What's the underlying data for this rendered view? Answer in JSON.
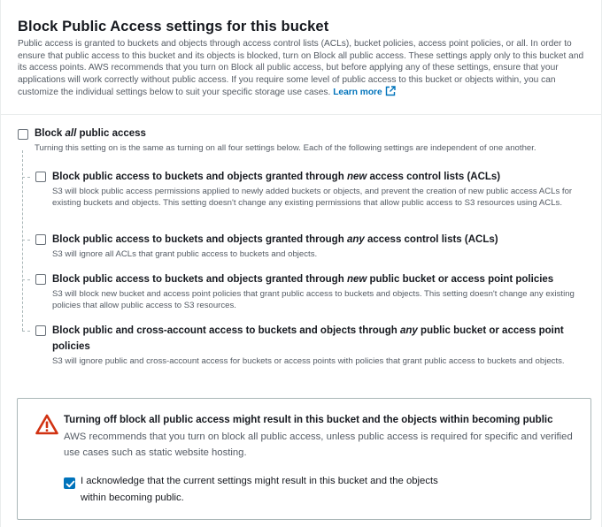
{
  "header": {
    "title": "Block Public Access settings for this bucket",
    "description": "Public access is granted to buckets and objects through access control lists (ACLs), bucket policies, access point policies, or all. In order to ensure that public access to this bucket and its objects is blocked, turn on Block all public access. These settings apply only to this bucket and its access points. AWS recommends that you turn on Block all public access, but before applying any of these settings, ensure that your applications will work correctly without public access. If you require some level of public access to this bucket or objects within, you can customize the individual settings below to suit your specific storage use cases.",
    "learn_more": "Learn more"
  },
  "block_all": {
    "label_pre": "Block ",
    "label_em": "all",
    "label_post": " public access",
    "description": "Turning this setting on is the same as turning on all four settings below. Each of the following settings are independent of one another.",
    "checked": false
  },
  "options": [
    {
      "label_pre": "Block public access to buckets and objects granted through ",
      "label_em": "new",
      "label_post": " access control lists (ACLs)",
      "description": "S3 will block public access permissions applied to newly added buckets or objects, and prevent the creation of new public access ACLs for existing buckets and objects. This setting doesn't change any existing permissions that allow public access to S3 resources using ACLs.",
      "checked": false
    },
    {
      "label_pre": "Block public access to buckets and objects granted through ",
      "label_em": "any",
      "label_post": " access control lists (ACLs)",
      "description": "S3 will ignore all ACLs that grant public access to buckets and objects.",
      "checked": false
    },
    {
      "label_pre": "Block public access to buckets and objects granted through ",
      "label_em": "new",
      "label_post": " public bucket or access point policies",
      "description": "S3 will block new bucket and access point policies that grant public access to buckets and objects. This setting doesn't change any existing policies that allow public access to S3 resources.",
      "checked": false
    },
    {
      "label_pre": "Block public and cross-account access to buckets and objects through ",
      "label_em": "any",
      "label_post": " public bucket or access point policies",
      "description": "S3 will ignore public and cross-account access for buckets or access points with policies that grant public access to buckets and objects.",
      "checked": false
    }
  ],
  "warning": {
    "title": "Turning off block all public access might result in this bucket and the objects within becoming public",
    "text": "AWS recommends that you turn on block all public access, unless public access is required for specific and verified use cases such as static website hosting.",
    "acknowledge": "I acknowledge that the current settings might result in this bucket and the objects within becoming public.",
    "acknowledged": true
  },
  "icons": {
    "warning": "warning-triangle-icon",
    "external_link": "external-link-icon",
    "check": "check-icon"
  },
  "colors": {
    "accent": "#0073bb",
    "warning": "#d13212",
    "text": "#16191f",
    "muted": "#545b64"
  }
}
